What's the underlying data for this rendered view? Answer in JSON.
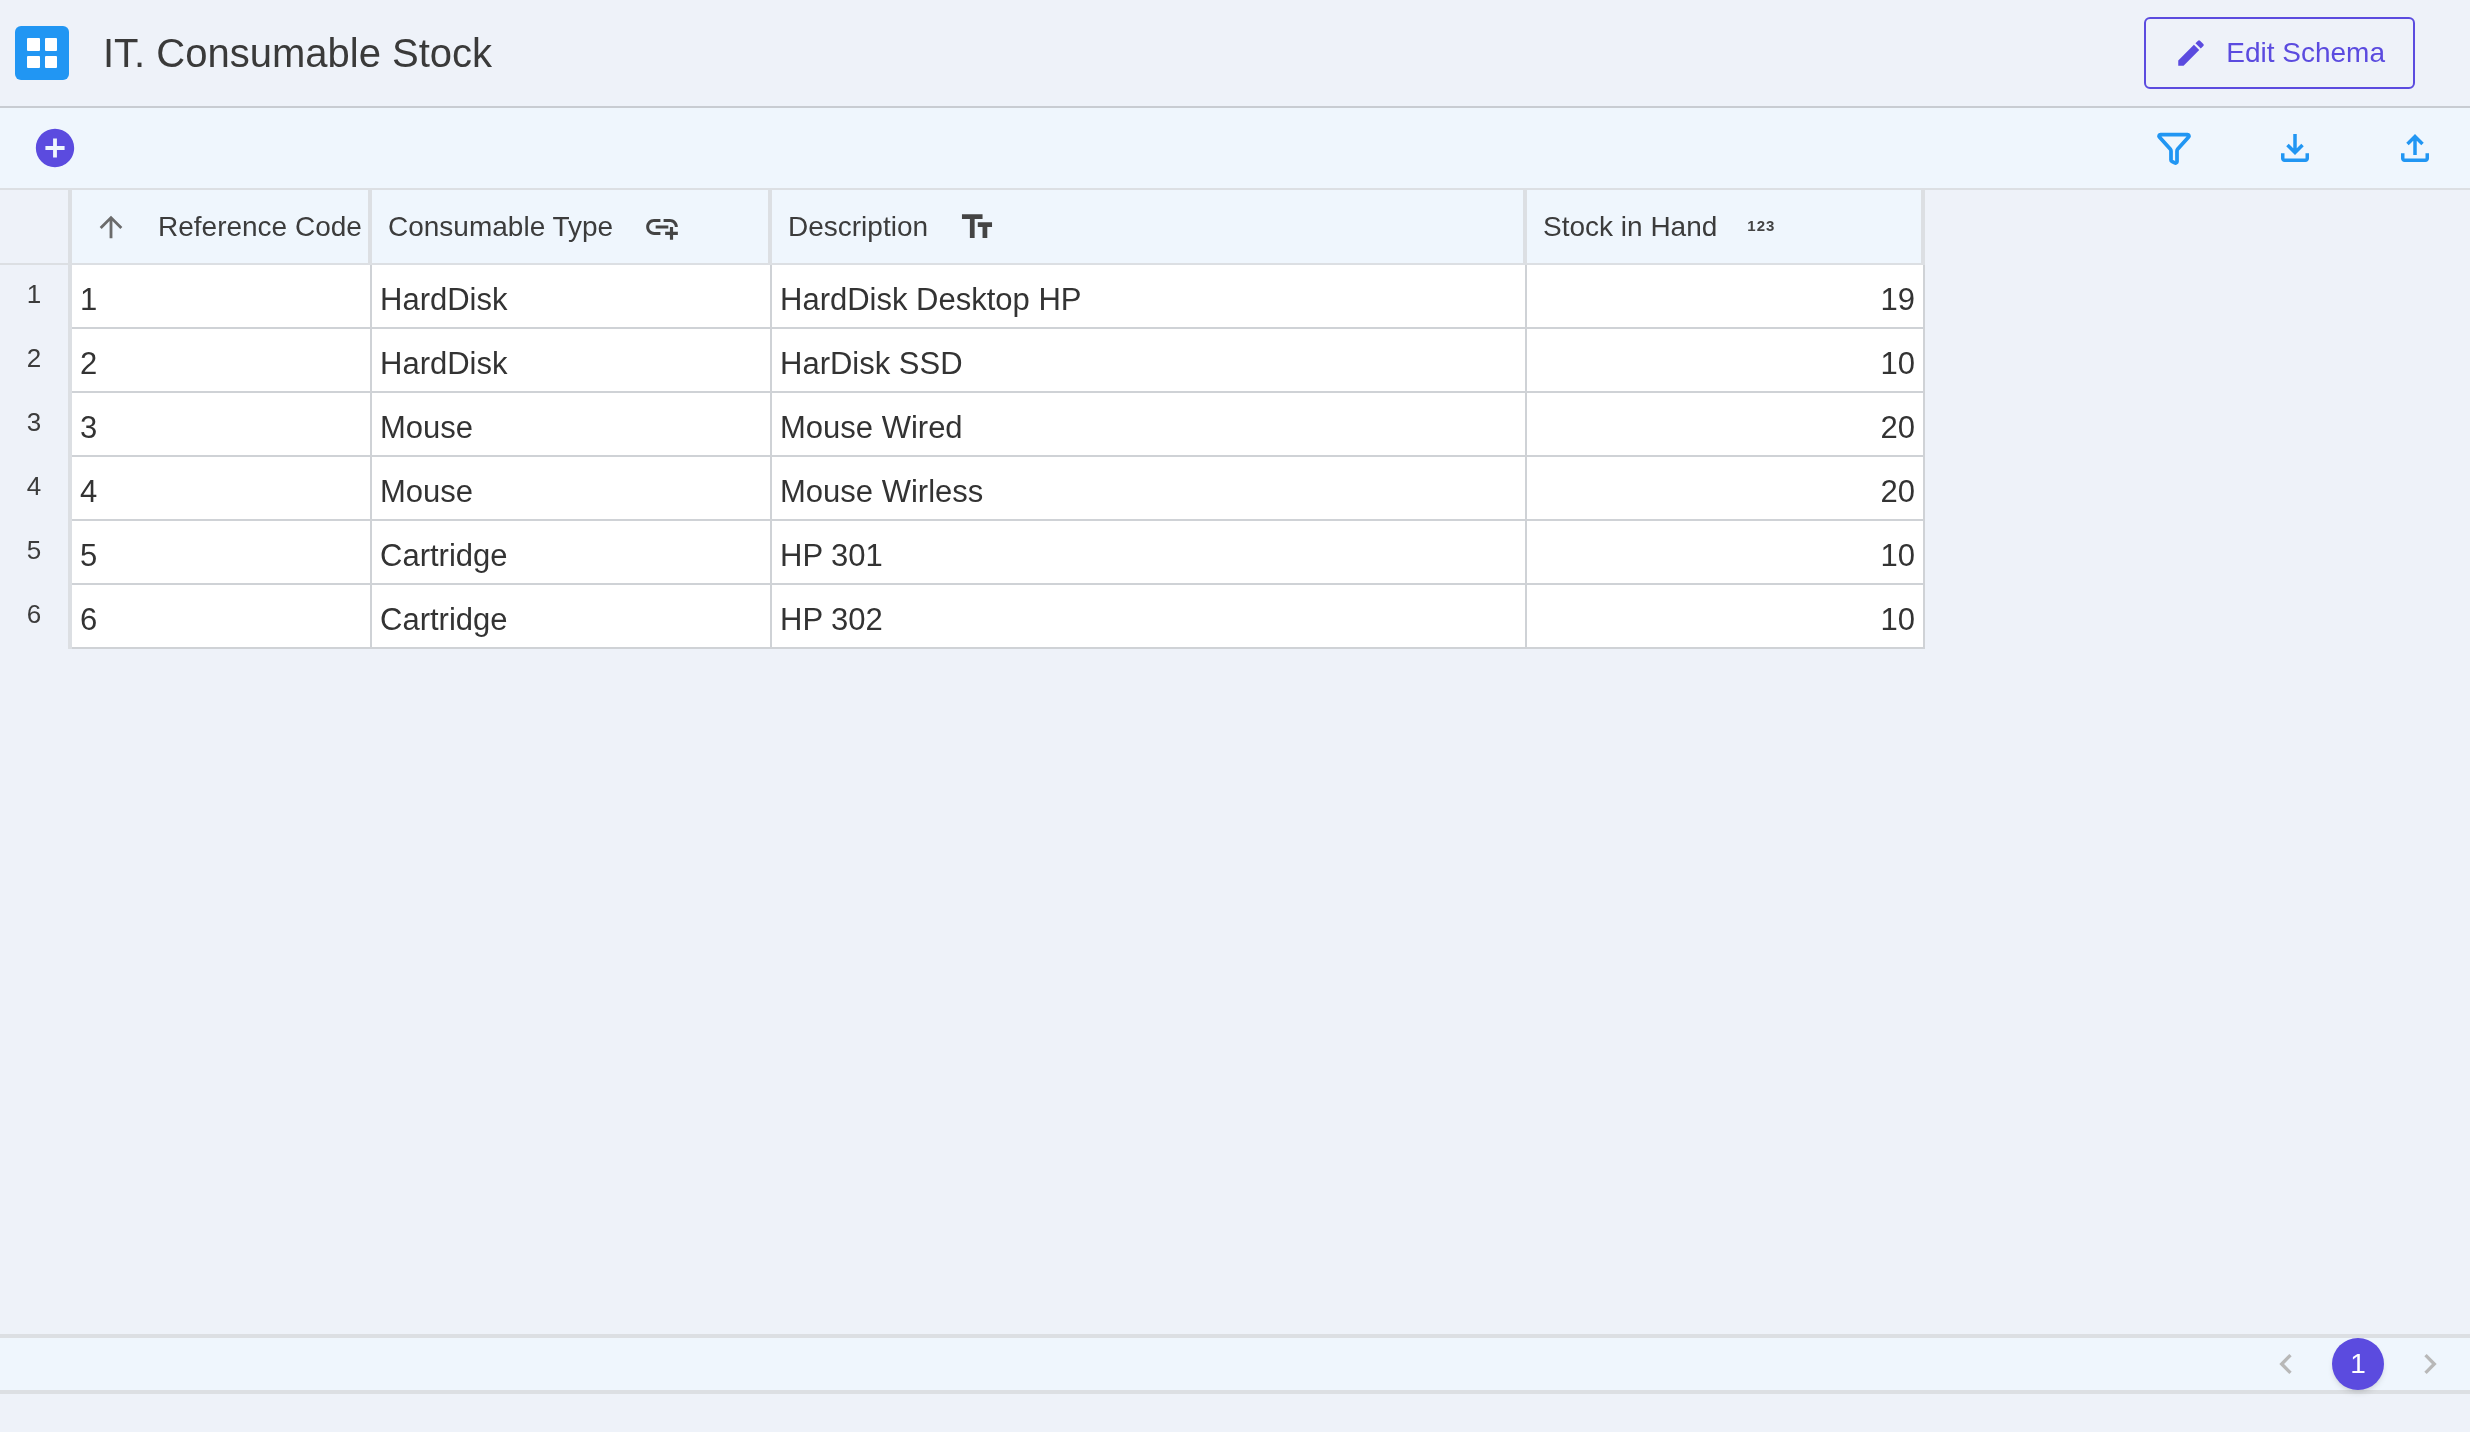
{
  "header": {
    "title": "IT. Consumable Stock",
    "edit_button": "Edit Schema"
  },
  "table": {
    "columns": [
      {
        "label": "Reference Code",
        "kind": "sort"
      },
      {
        "label": "Consumable Type",
        "kind": "link"
      },
      {
        "label": "Description",
        "kind": "text"
      },
      {
        "label": "Stock in Hand",
        "kind": "number",
        "type_mark": "123"
      }
    ],
    "rows": [
      {
        "number": "1",
        "cells": [
          "1",
          "HardDisk",
          "HardDisk Desktop HP",
          "19"
        ]
      },
      {
        "number": "2",
        "cells": [
          "2",
          "HardDisk",
          "HarDisk SSD",
          "10"
        ]
      },
      {
        "number": "3",
        "cells": [
          "3",
          "Mouse",
          "Mouse Wired",
          "20"
        ]
      },
      {
        "number": "4",
        "cells": [
          "4",
          "Mouse",
          "Mouse Wirless",
          "20"
        ]
      },
      {
        "number": "5",
        "cells": [
          "5",
          "Cartridge",
          "HP 301",
          "10"
        ]
      },
      {
        "number": "6",
        "cells": [
          "6",
          "Cartridge",
          "HP 302",
          "10"
        ]
      }
    ]
  },
  "pagination": {
    "pages": [
      {
        "label": "1",
        "selected": true
      }
    ]
  }
}
